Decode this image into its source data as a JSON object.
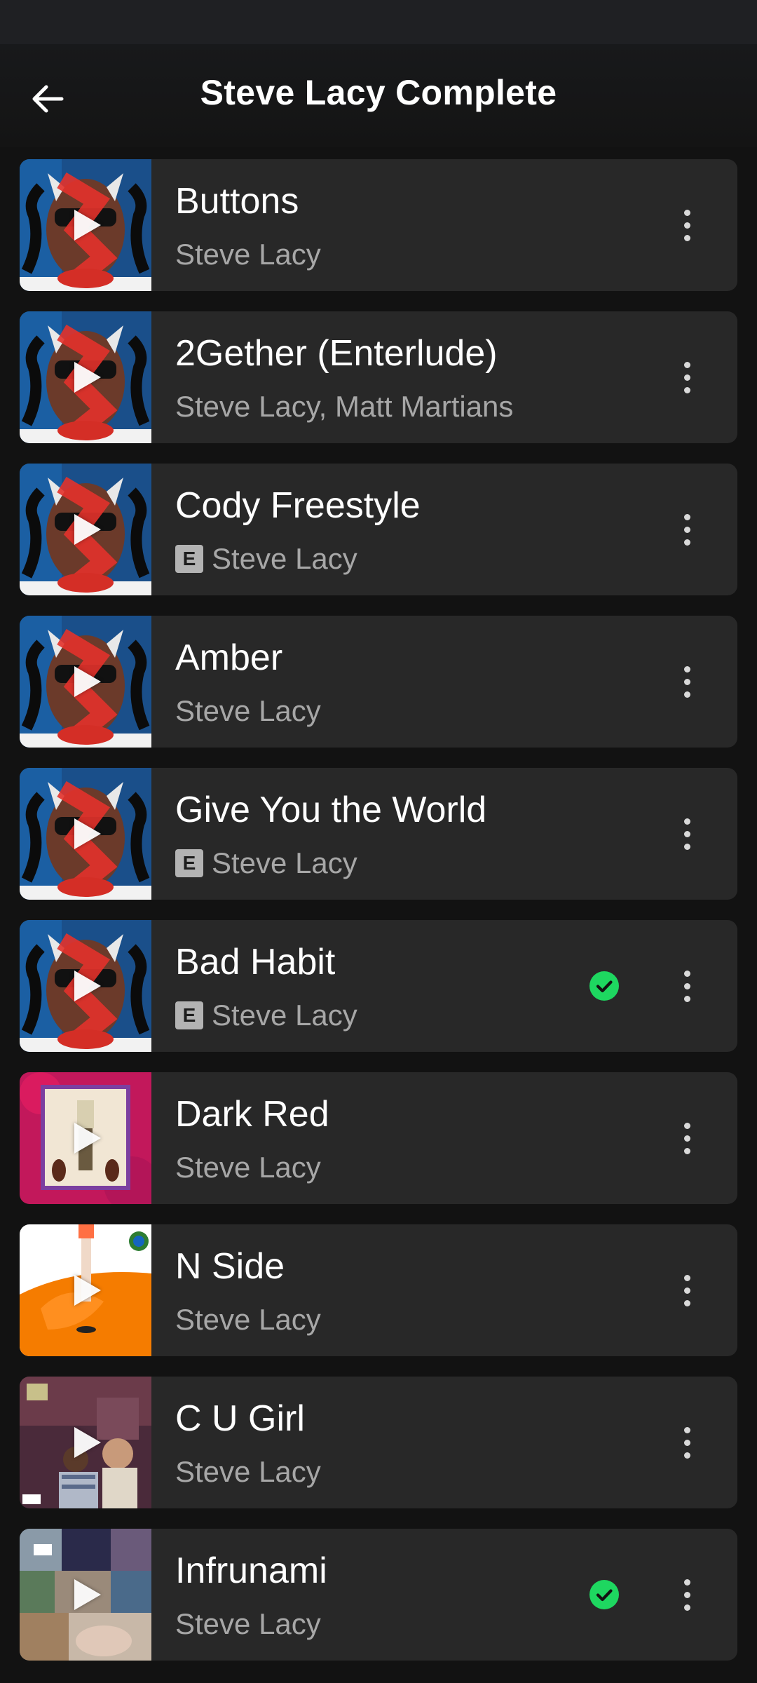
{
  "header": {
    "title": "Steve Lacy Complete",
    "back_icon": "arrow-left-icon"
  },
  "colors": {
    "background": "#121212",
    "row_background": "#282828",
    "downloaded_green": "#1ed760",
    "secondary_text": "#a7a7a7"
  },
  "tracks": [
    {
      "title": "Buttons",
      "artist": "Steve Lacy",
      "explicit": false,
      "downloaded": false,
      "art": "gemini-rights"
    },
    {
      "title": "2Gether (Enterlude)",
      "artist": "Steve Lacy, Matt Martians",
      "explicit": false,
      "downloaded": false,
      "art": "gemini-rights"
    },
    {
      "title": "Cody Freestyle",
      "artist": "Steve Lacy",
      "explicit": true,
      "downloaded": false,
      "art": "gemini-rights"
    },
    {
      "title": "Amber",
      "artist": "Steve Lacy",
      "explicit": false,
      "downloaded": false,
      "art": "gemini-rights"
    },
    {
      "title": "Give You the World",
      "artist": "Steve Lacy",
      "explicit": true,
      "downloaded": false,
      "art": "gemini-rights"
    },
    {
      "title": "Bad Habit",
      "artist": "Steve Lacy",
      "explicit": true,
      "downloaded": true,
      "art": "gemini-rights"
    },
    {
      "title": "Dark Red",
      "artist": "Steve Lacy",
      "explicit": false,
      "downloaded": false,
      "art": "dark-red"
    },
    {
      "title": "N Side",
      "artist": "Steve Lacy",
      "explicit": false,
      "downloaded": false,
      "art": "apollo-xxi"
    },
    {
      "title": "C U Girl",
      "artist": "Steve Lacy",
      "explicit": false,
      "downloaded": false,
      "art": "demo"
    },
    {
      "title": "Infrunami",
      "artist": "Steve Lacy",
      "explicit": false,
      "downloaded": true,
      "art": "collage"
    }
  ],
  "explicit_label": "E"
}
